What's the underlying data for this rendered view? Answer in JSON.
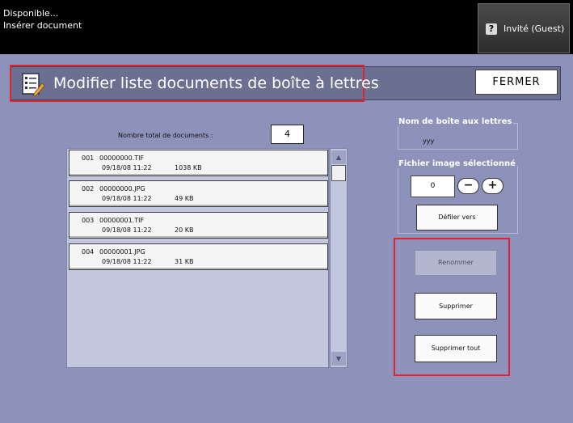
{
  "status": {
    "line1": "Disponible...",
    "line2": "Insérer document"
  },
  "user": {
    "icon": "help-icon",
    "label": "Invité (Guest)"
  },
  "dialog": {
    "title": "Modifier liste documents de boîte à lettres",
    "title_icon": "edit-list-icon",
    "close_label": "FERMER",
    "highlight_color": "#e0242e"
  },
  "documents": {
    "total_label": "Nombre total de documents :",
    "total_value": "4",
    "items": [
      {
        "num": "001",
        "name": "00000000.TIF",
        "date": "09/18/08 11:22",
        "size": "1038 KB"
      },
      {
        "num": "002",
        "name": "00000000.JPG",
        "date": "09/18/08 11:22",
        "size": "49 KB"
      },
      {
        "num": "003",
        "name": "00000001.TIF",
        "date": "09/18/08 11:22",
        "size": "20 KB"
      },
      {
        "num": "004",
        "name": "00000001.JPG",
        "date": "09/18/08 11:22",
        "size": "31 KB"
      }
    ],
    "scroll_up_icon": "triangle-up-icon",
    "scroll_down_icon": "triangle-down-icon"
  },
  "mailbox": {
    "label": "Nom de boîte aux lettres",
    "value": "yyy"
  },
  "selected_image": {
    "label": "Fichier image sélectionné",
    "value": "0",
    "minus_label": "−",
    "plus_label": "+",
    "scroll_to_label": "Défiler vers"
  },
  "actions": {
    "rename_label": "Renommer",
    "delete_label": "Supprimer",
    "delete_all_label": "Supprimer tout"
  }
}
